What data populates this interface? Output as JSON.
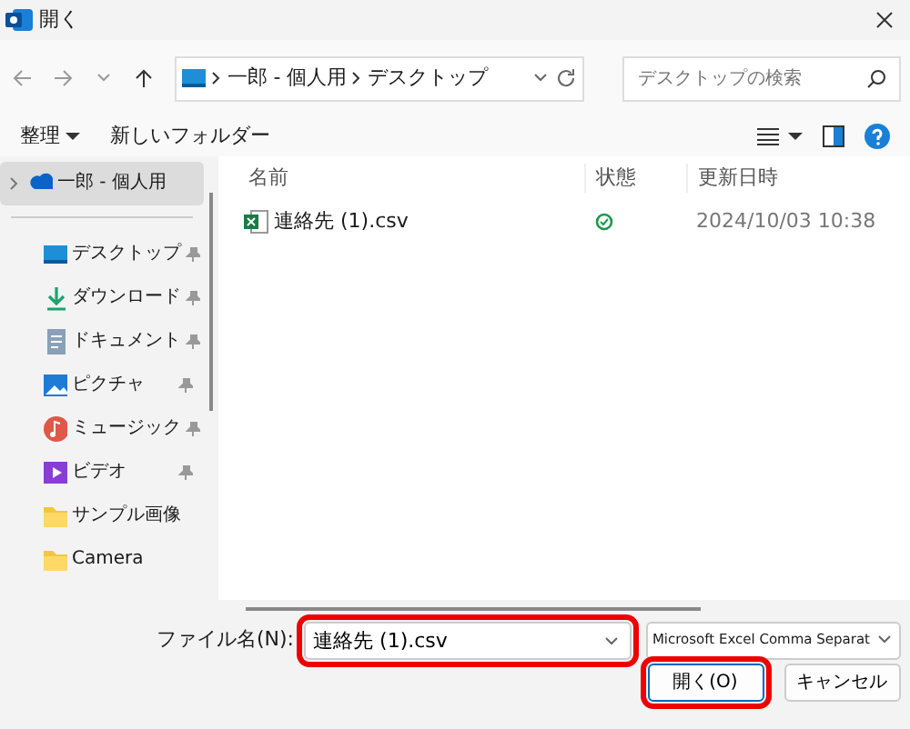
{
  "window": {
    "title": "開く"
  },
  "address": {
    "path": [
      {
        "label": "一郎 - 個人用"
      },
      {
        "label": "デスクトップ"
      }
    ]
  },
  "search": {
    "placeholder": "デスクトップの検索"
  },
  "toolbar": {
    "organize": "整理",
    "new_folder": "新しいフォルダー"
  },
  "sidebar": {
    "items": [
      {
        "label": "一郎 - 個人用",
        "kind": "cloud",
        "pinned": false,
        "selected": true,
        "expandable": true
      },
      {
        "label": "デスクトップ",
        "kind": "desktop",
        "pinned": true,
        "selected": false,
        "expandable": false
      },
      {
        "label": "ダウンロード",
        "kind": "download",
        "pinned": true,
        "selected": false,
        "expandable": false
      },
      {
        "label": "ドキュメント",
        "kind": "document",
        "pinned": true,
        "selected": false,
        "expandable": false
      },
      {
        "label": "ピクチャ",
        "kind": "picture",
        "pinned": true,
        "selected": false,
        "expandable": false
      },
      {
        "label": "ミュージック",
        "kind": "music",
        "pinned": true,
        "selected": false,
        "expandable": false
      },
      {
        "label": "ビデオ",
        "kind": "video",
        "pinned": true,
        "selected": false,
        "expandable": false
      },
      {
        "label": "サンプル画像",
        "kind": "folder",
        "pinned": false,
        "selected": false,
        "expandable": false
      },
      {
        "label": "Camera",
        "kind": "folder",
        "pinned": false,
        "selected": false,
        "expandable": false
      }
    ]
  },
  "table": {
    "columns": [
      "名前",
      "状態",
      "更新日時"
    ],
    "rows": [
      {
        "name": "連絡先 (1).csv",
        "synced": true,
        "modified": "2024/10/03 10:38"
      }
    ]
  },
  "footer": {
    "filename_label": "ファイル名(N):",
    "filename": "連絡先 (1).csv",
    "filename_highlighted": true,
    "filetype": "Microsoft Excel Comma Separat",
    "open_button": "開く(O)",
    "open_highlighted": true,
    "cancel_button": "キャンセル"
  }
}
